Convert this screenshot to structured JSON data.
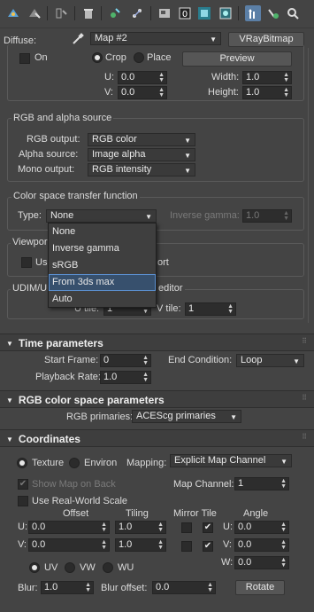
{
  "toolbar": {
    "icons": [
      "get-material-icon",
      "put-material-icon",
      "assign-material-icon",
      "delete-icon",
      "copy-map-icon",
      "make-unique-icon",
      "put-to-library-icon",
      "material-id-icon",
      "show-shaded-icon",
      "show-end-result-icon",
      "go-to-parent-icon",
      "go-forward-icon",
      "pick-material-icon"
    ],
    "material_id": "0"
  },
  "diffuse": {
    "label": "Diffuse:",
    "map_name": "Map #2",
    "map_type": "VRayBitmap"
  },
  "crop": {
    "on_label": "On",
    "crop_label": "Crop",
    "place_label": "Place",
    "preview_label": "Preview",
    "u_label": "U:",
    "u": "0.0",
    "v_label": "V:",
    "v": "0.0",
    "width_label": "Width:",
    "width": "1.0",
    "height_label": "Height:",
    "height": "1.0"
  },
  "rgb_alpha": {
    "title": "RGB and alpha source",
    "rgb_output_label": "RGB output:",
    "rgb_output": "RGB color",
    "alpha_source_label": "Alpha source:",
    "alpha_source": "Image alpha",
    "mono_output_label": "Mono output:",
    "mono_output": "RGB intensity"
  },
  "color_space": {
    "title": "Color space transfer function",
    "type_label": "Type:",
    "type_value": "None",
    "inverse_gamma_label": "Inverse gamma:",
    "inverse_gamma": "1.0",
    "options": [
      "None",
      "Inverse gamma",
      "sRGB",
      "From 3ds max",
      "Auto"
    ],
    "highlighted_index": 3
  },
  "viewport": {
    "title_visible": "Viewpor",
    "use_visible": "Us",
    "ort_visible": "ort"
  },
  "udim": {
    "title_visible": "UDIM/U",
    "editor_visible": "editor",
    "u_tile_visible": "U tile:",
    "u_tile": "1",
    "v_tile_label": "V tile:",
    "v_tile": "1"
  },
  "time": {
    "title": "Time parameters",
    "start_frame_label": "Start Frame:",
    "start_frame": "0",
    "end_condition_label": "End Condition:",
    "end_condition": "Loop",
    "playback_rate_label": "Playback Rate:",
    "playback_rate": "1.0"
  },
  "rgb_cs": {
    "title": "RGB color space parameters",
    "primaries_label": "RGB primaries:",
    "primaries": "ACEScg primaries"
  },
  "coords": {
    "title": "Coordinates",
    "texture_label": "Texture",
    "environ_label": "Environ",
    "mapping_label": "Mapping:",
    "mapping": "Explicit Map Channel",
    "show_map_label": "Show Map on Back",
    "map_channel_label": "Map Channel:",
    "map_channel": "1",
    "real_world_label": "Use Real-World Scale",
    "offset_label": "Offset",
    "tiling_label": "Tiling",
    "mirror_tile_label": "Mirror Tile",
    "angle_label": "Angle",
    "u_label": "U:",
    "v_label": "V:",
    "w_label": "W:",
    "u_offset": "0.0",
    "v_offset": "0.0",
    "u_tiling": "1.0",
    "v_tiling": "1.0",
    "u_angle": "0.0",
    "v_angle": "0.0",
    "w_angle": "0.0",
    "uv_label": "UV",
    "vw_label": "VW",
    "wu_label": "WU",
    "blur_label": "Blur:",
    "blur": "1.0",
    "blur_offset_label": "Blur offset:",
    "blur_offset": "0.0",
    "rotate_label": "Rotate"
  },
  "colors": {
    "background": "#444444",
    "field": "#2d2d2d",
    "highlight": "#37506d",
    "accent": "#5b7fa6"
  }
}
